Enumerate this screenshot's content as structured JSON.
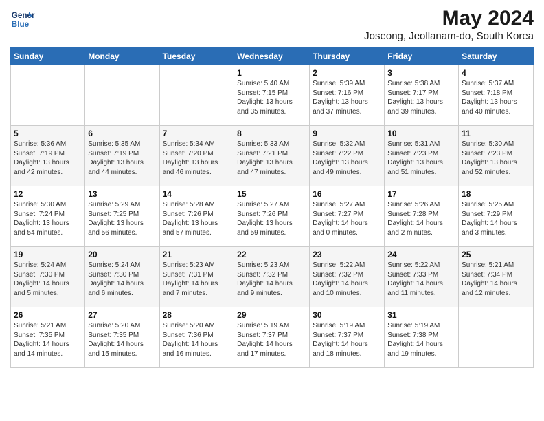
{
  "header": {
    "logo_line1": "General",
    "logo_line2": "Blue",
    "month_year": "May 2024",
    "location": "Joseong, Jeollanam-do, South Korea"
  },
  "weekdays": [
    "Sunday",
    "Monday",
    "Tuesday",
    "Wednesday",
    "Thursday",
    "Friday",
    "Saturday"
  ],
  "weeks": [
    [
      {
        "day": "",
        "info": ""
      },
      {
        "day": "",
        "info": ""
      },
      {
        "day": "",
        "info": ""
      },
      {
        "day": "1",
        "info": "Sunrise: 5:40 AM\nSunset: 7:15 PM\nDaylight: 13 hours\nand 35 minutes."
      },
      {
        "day": "2",
        "info": "Sunrise: 5:39 AM\nSunset: 7:16 PM\nDaylight: 13 hours\nand 37 minutes."
      },
      {
        "day": "3",
        "info": "Sunrise: 5:38 AM\nSunset: 7:17 PM\nDaylight: 13 hours\nand 39 minutes."
      },
      {
        "day": "4",
        "info": "Sunrise: 5:37 AM\nSunset: 7:18 PM\nDaylight: 13 hours\nand 40 minutes."
      }
    ],
    [
      {
        "day": "5",
        "info": "Sunrise: 5:36 AM\nSunset: 7:19 PM\nDaylight: 13 hours\nand 42 minutes."
      },
      {
        "day": "6",
        "info": "Sunrise: 5:35 AM\nSunset: 7:19 PM\nDaylight: 13 hours\nand 44 minutes."
      },
      {
        "day": "7",
        "info": "Sunrise: 5:34 AM\nSunset: 7:20 PM\nDaylight: 13 hours\nand 46 minutes."
      },
      {
        "day": "8",
        "info": "Sunrise: 5:33 AM\nSunset: 7:21 PM\nDaylight: 13 hours\nand 47 minutes."
      },
      {
        "day": "9",
        "info": "Sunrise: 5:32 AM\nSunset: 7:22 PM\nDaylight: 13 hours\nand 49 minutes."
      },
      {
        "day": "10",
        "info": "Sunrise: 5:31 AM\nSunset: 7:23 PM\nDaylight: 13 hours\nand 51 minutes."
      },
      {
        "day": "11",
        "info": "Sunrise: 5:30 AM\nSunset: 7:23 PM\nDaylight: 13 hours\nand 52 minutes."
      }
    ],
    [
      {
        "day": "12",
        "info": "Sunrise: 5:30 AM\nSunset: 7:24 PM\nDaylight: 13 hours\nand 54 minutes."
      },
      {
        "day": "13",
        "info": "Sunrise: 5:29 AM\nSunset: 7:25 PM\nDaylight: 13 hours\nand 56 minutes."
      },
      {
        "day": "14",
        "info": "Sunrise: 5:28 AM\nSunset: 7:26 PM\nDaylight: 13 hours\nand 57 minutes."
      },
      {
        "day": "15",
        "info": "Sunrise: 5:27 AM\nSunset: 7:26 PM\nDaylight: 13 hours\nand 59 minutes."
      },
      {
        "day": "16",
        "info": "Sunrise: 5:27 AM\nSunset: 7:27 PM\nDaylight: 14 hours\nand 0 minutes."
      },
      {
        "day": "17",
        "info": "Sunrise: 5:26 AM\nSunset: 7:28 PM\nDaylight: 14 hours\nand 2 minutes."
      },
      {
        "day": "18",
        "info": "Sunrise: 5:25 AM\nSunset: 7:29 PM\nDaylight: 14 hours\nand 3 minutes."
      }
    ],
    [
      {
        "day": "19",
        "info": "Sunrise: 5:24 AM\nSunset: 7:30 PM\nDaylight: 14 hours\nand 5 minutes."
      },
      {
        "day": "20",
        "info": "Sunrise: 5:24 AM\nSunset: 7:30 PM\nDaylight: 14 hours\nand 6 minutes."
      },
      {
        "day": "21",
        "info": "Sunrise: 5:23 AM\nSunset: 7:31 PM\nDaylight: 14 hours\nand 7 minutes."
      },
      {
        "day": "22",
        "info": "Sunrise: 5:23 AM\nSunset: 7:32 PM\nDaylight: 14 hours\nand 9 minutes."
      },
      {
        "day": "23",
        "info": "Sunrise: 5:22 AM\nSunset: 7:32 PM\nDaylight: 14 hours\nand 10 minutes."
      },
      {
        "day": "24",
        "info": "Sunrise: 5:22 AM\nSunset: 7:33 PM\nDaylight: 14 hours\nand 11 minutes."
      },
      {
        "day": "25",
        "info": "Sunrise: 5:21 AM\nSunset: 7:34 PM\nDaylight: 14 hours\nand 12 minutes."
      }
    ],
    [
      {
        "day": "26",
        "info": "Sunrise: 5:21 AM\nSunset: 7:35 PM\nDaylight: 14 hours\nand 14 minutes."
      },
      {
        "day": "27",
        "info": "Sunrise: 5:20 AM\nSunset: 7:35 PM\nDaylight: 14 hours\nand 15 minutes."
      },
      {
        "day": "28",
        "info": "Sunrise: 5:20 AM\nSunset: 7:36 PM\nDaylight: 14 hours\nand 16 minutes."
      },
      {
        "day": "29",
        "info": "Sunrise: 5:19 AM\nSunset: 7:37 PM\nDaylight: 14 hours\nand 17 minutes."
      },
      {
        "day": "30",
        "info": "Sunrise: 5:19 AM\nSunset: 7:37 PM\nDaylight: 14 hours\nand 18 minutes."
      },
      {
        "day": "31",
        "info": "Sunrise: 5:19 AM\nSunset: 7:38 PM\nDaylight: 14 hours\nand 19 minutes."
      },
      {
        "day": "",
        "info": ""
      }
    ]
  ]
}
